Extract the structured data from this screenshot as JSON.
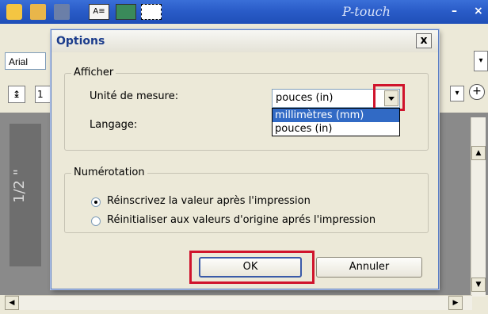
{
  "app": {
    "brand": "P-touch",
    "font_name": "Arial",
    "font_size": "1",
    "ruler_label": "1/2 \"",
    "minimize_label": "–",
    "close_label": "×"
  },
  "dialog": {
    "title": "Options",
    "close_label": "x",
    "afficher": {
      "legend": "Afficher",
      "unit_label": "Unité de mesure:",
      "unit_value": "pouces (in)",
      "unit_options": [
        "millimètres (mm)",
        "pouces (in)"
      ],
      "highlighted_option_index": 0,
      "language_label": "Langage:"
    },
    "numerotation": {
      "legend": "Numérotation",
      "options": [
        {
          "label": "Réinscrivez la valeur après l'impression",
          "checked": true
        },
        {
          "label": "Réinitialiser aux valeurs d'origine aprés l'impression",
          "checked": false
        }
      ]
    },
    "ok_label": "OK",
    "cancel_label": "Annuler"
  },
  "colors": {
    "highlight_box": "#d0142c",
    "selection": "#316ac5",
    "titlebar": "#2a5cc8"
  }
}
